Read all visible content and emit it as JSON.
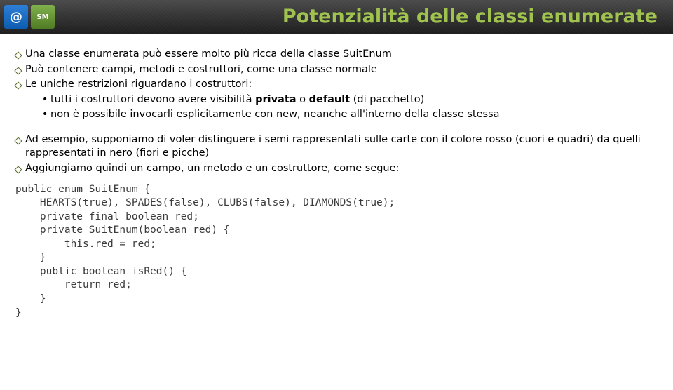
{
  "header": {
    "logo_blue": "@",
    "logo_green_top": "S",
    "logo_green_bottom": "M",
    "title": "Potenzialità delle classi enumerate"
  },
  "bullets": {
    "b1": "Una classe enumerata può essere molto più ricca della classe SuitEnum",
    "b2": "Può contenere campi, metodi e costruttori, come una classe normale",
    "b3": "Le uniche restrizioni riguardano i costruttori:",
    "sub1_pre": "tutti i costruttori devono avere visibilità ",
    "sub1_bold1": "privata",
    "sub1_mid": " o ",
    "sub1_bold2": "default",
    "sub1_post": " (di pacchetto)",
    "sub2": "non è possibile invocarli esplicitamente con new, neanche all'interno della classe stessa",
    "b4": "Ad esempio, supponiamo di voler distinguere i semi rappresentati sulle carte con il colore rosso (cuori e quadri) da quelli rappresentati in nero (fiori e picche)",
    "b5": "Aggiungiamo quindi un campo, un metodo e un costruttore, come segue:"
  },
  "code": "public enum SuitEnum {\n    HEARTS(true), SPADES(false), CLUBS(false), DIAMONDS(true);\n    private final boolean red;\n    private SuitEnum(boolean red) {\n        this.red = red;\n    }\n    public boolean isRed() {\n        return red;\n    }\n}"
}
